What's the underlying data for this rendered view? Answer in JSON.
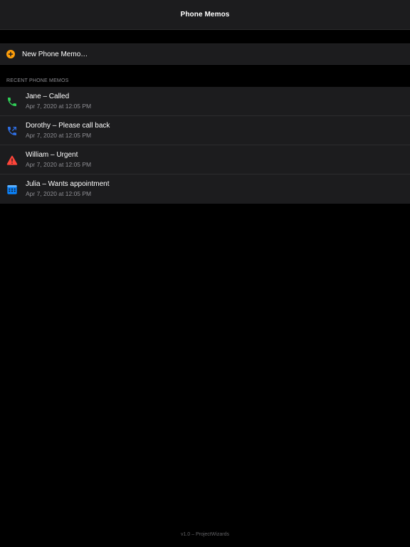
{
  "navbar": {
    "title": "Phone Memos"
  },
  "new_memo": {
    "label": "New Phone Memo…",
    "icon": "plus-circle-icon",
    "icon_color": "#ff9f0a"
  },
  "section": {
    "header": "RECENT PHONE MEMOS"
  },
  "memos": [
    {
      "title": "Jane – Called",
      "date": "Apr 7, 2020 at 12:05 PM",
      "icon": "phone-icon",
      "icon_color": "#30d158"
    },
    {
      "title": "Dorothy – Please call back",
      "date": "Apr 7, 2020 at 12:05 PM",
      "icon": "phone-callback-icon",
      "icon_color": "#2f6fe4"
    },
    {
      "title": "William – Urgent",
      "date": "Apr 7, 2020 at 12:05 PM",
      "icon": "warning-icon",
      "icon_color": "#ff453a"
    },
    {
      "title": "Julia – Wants appointment",
      "date": "Apr 7, 2020 at 12:05 PM",
      "icon": "calendar-icon",
      "icon_color": "#0a84ff"
    }
  ],
  "footer": {
    "text": "v1.0 – ProjectWizards"
  }
}
